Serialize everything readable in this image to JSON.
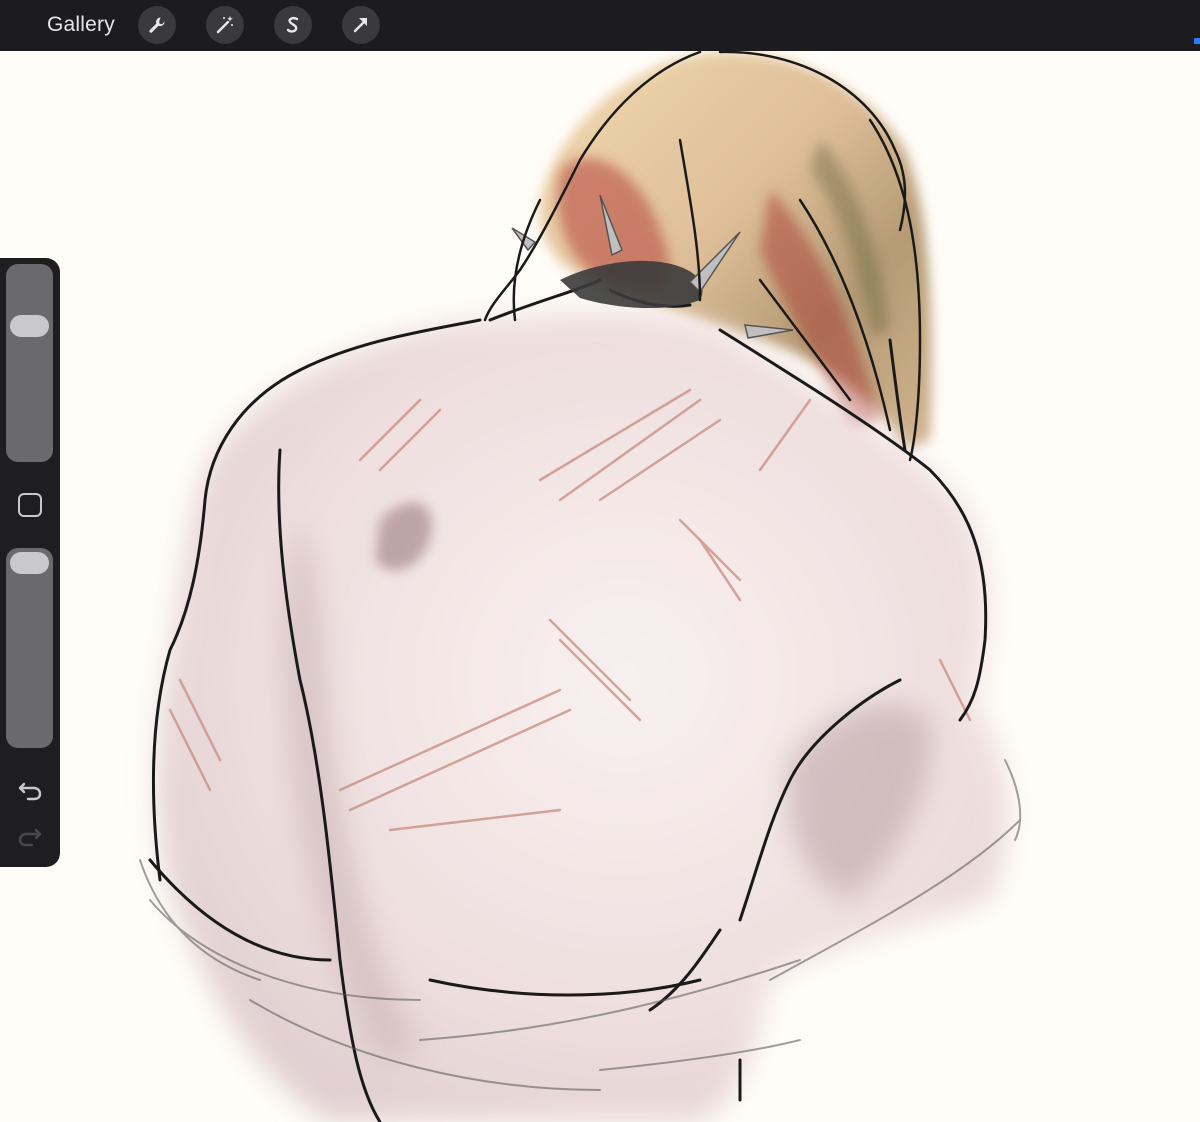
{
  "toolbar": {
    "gallery_label": "Gallery",
    "tools": [
      {
        "icon": "wrench-icon",
        "name": "actions"
      },
      {
        "icon": "magic-wand-icon",
        "name": "adjustments"
      },
      {
        "icon": "selection-s-icon",
        "name": "selection"
      },
      {
        "icon": "arrow-cursor-icon",
        "name": "transform"
      }
    ]
  },
  "sidebar": {
    "brush_size_level": 0.28,
    "opacity_level": 0.0,
    "modify_icon": "square-modify-icon",
    "undo_icon": "undo-icon",
    "redo_icon": "redo-icon"
  },
  "colors": {
    "toolbar_bg": "#1c1c1e",
    "button_bg": "#3a3a3c",
    "canvas_bg": "#fffdf8",
    "sidebar_bg": "#1e1e20",
    "accent": "#2f7bff"
  }
}
